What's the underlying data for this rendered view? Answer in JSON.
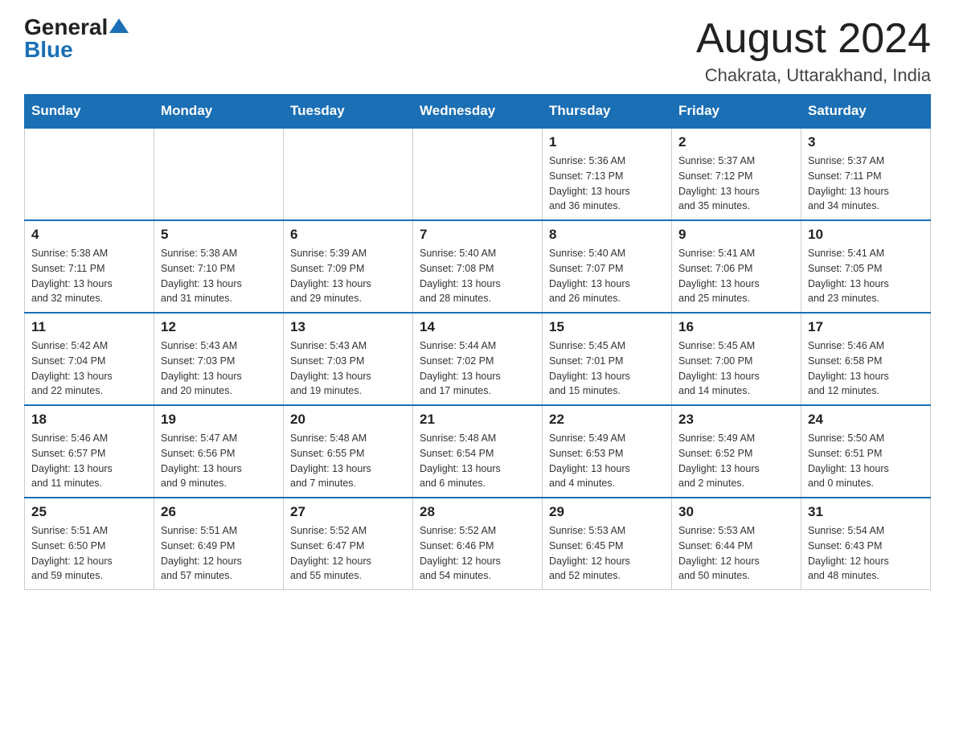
{
  "logo": {
    "general": "General",
    "blue": "Blue"
  },
  "header": {
    "month_title": "August 2024",
    "location": "Chakrata, Uttarakhand, India"
  },
  "weekdays": [
    "Sunday",
    "Monday",
    "Tuesday",
    "Wednesday",
    "Thursday",
    "Friday",
    "Saturday"
  ],
  "weeks": [
    [
      {
        "day": "",
        "info": ""
      },
      {
        "day": "",
        "info": ""
      },
      {
        "day": "",
        "info": ""
      },
      {
        "day": "",
        "info": ""
      },
      {
        "day": "1",
        "info": "Sunrise: 5:36 AM\nSunset: 7:13 PM\nDaylight: 13 hours\nand 36 minutes."
      },
      {
        "day": "2",
        "info": "Sunrise: 5:37 AM\nSunset: 7:12 PM\nDaylight: 13 hours\nand 35 minutes."
      },
      {
        "day": "3",
        "info": "Sunrise: 5:37 AM\nSunset: 7:11 PM\nDaylight: 13 hours\nand 34 minutes."
      }
    ],
    [
      {
        "day": "4",
        "info": "Sunrise: 5:38 AM\nSunset: 7:11 PM\nDaylight: 13 hours\nand 32 minutes."
      },
      {
        "day": "5",
        "info": "Sunrise: 5:38 AM\nSunset: 7:10 PM\nDaylight: 13 hours\nand 31 minutes."
      },
      {
        "day": "6",
        "info": "Sunrise: 5:39 AM\nSunset: 7:09 PM\nDaylight: 13 hours\nand 29 minutes."
      },
      {
        "day": "7",
        "info": "Sunrise: 5:40 AM\nSunset: 7:08 PM\nDaylight: 13 hours\nand 28 minutes."
      },
      {
        "day": "8",
        "info": "Sunrise: 5:40 AM\nSunset: 7:07 PM\nDaylight: 13 hours\nand 26 minutes."
      },
      {
        "day": "9",
        "info": "Sunrise: 5:41 AM\nSunset: 7:06 PM\nDaylight: 13 hours\nand 25 minutes."
      },
      {
        "day": "10",
        "info": "Sunrise: 5:41 AM\nSunset: 7:05 PM\nDaylight: 13 hours\nand 23 minutes."
      }
    ],
    [
      {
        "day": "11",
        "info": "Sunrise: 5:42 AM\nSunset: 7:04 PM\nDaylight: 13 hours\nand 22 minutes."
      },
      {
        "day": "12",
        "info": "Sunrise: 5:43 AM\nSunset: 7:03 PM\nDaylight: 13 hours\nand 20 minutes."
      },
      {
        "day": "13",
        "info": "Sunrise: 5:43 AM\nSunset: 7:03 PM\nDaylight: 13 hours\nand 19 minutes."
      },
      {
        "day": "14",
        "info": "Sunrise: 5:44 AM\nSunset: 7:02 PM\nDaylight: 13 hours\nand 17 minutes."
      },
      {
        "day": "15",
        "info": "Sunrise: 5:45 AM\nSunset: 7:01 PM\nDaylight: 13 hours\nand 15 minutes."
      },
      {
        "day": "16",
        "info": "Sunrise: 5:45 AM\nSunset: 7:00 PM\nDaylight: 13 hours\nand 14 minutes."
      },
      {
        "day": "17",
        "info": "Sunrise: 5:46 AM\nSunset: 6:58 PM\nDaylight: 13 hours\nand 12 minutes."
      }
    ],
    [
      {
        "day": "18",
        "info": "Sunrise: 5:46 AM\nSunset: 6:57 PM\nDaylight: 13 hours\nand 11 minutes."
      },
      {
        "day": "19",
        "info": "Sunrise: 5:47 AM\nSunset: 6:56 PM\nDaylight: 13 hours\nand 9 minutes."
      },
      {
        "day": "20",
        "info": "Sunrise: 5:48 AM\nSunset: 6:55 PM\nDaylight: 13 hours\nand 7 minutes."
      },
      {
        "day": "21",
        "info": "Sunrise: 5:48 AM\nSunset: 6:54 PM\nDaylight: 13 hours\nand 6 minutes."
      },
      {
        "day": "22",
        "info": "Sunrise: 5:49 AM\nSunset: 6:53 PM\nDaylight: 13 hours\nand 4 minutes."
      },
      {
        "day": "23",
        "info": "Sunrise: 5:49 AM\nSunset: 6:52 PM\nDaylight: 13 hours\nand 2 minutes."
      },
      {
        "day": "24",
        "info": "Sunrise: 5:50 AM\nSunset: 6:51 PM\nDaylight: 13 hours\nand 0 minutes."
      }
    ],
    [
      {
        "day": "25",
        "info": "Sunrise: 5:51 AM\nSunset: 6:50 PM\nDaylight: 12 hours\nand 59 minutes."
      },
      {
        "day": "26",
        "info": "Sunrise: 5:51 AM\nSunset: 6:49 PM\nDaylight: 12 hours\nand 57 minutes."
      },
      {
        "day": "27",
        "info": "Sunrise: 5:52 AM\nSunset: 6:47 PM\nDaylight: 12 hours\nand 55 minutes."
      },
      {
        "day": "28",
        "info": "Sunrise: 5:52 AM\nSunset: 6:46 PM\nDaylight: 12 hours\nand 54 minutes."
      },
      {
        "day": "29",
        "info": "Sunrise: 5:53 AM\nSunset: 6:45 PM\nDaylight: 12 hours\nand 52 minutes."
      },
      {
        "day": "30",
        "info": "Sunrise: 5:53 AM\nSunset: 6:44 PM\nDaylight: 12 hours\nand 50 minutes."
      },
      {
        "day": "31",
        "info": "Sunrise: 5:54 AM\nSunset: 6:43 PM\nDaylight: 12 hours\nand 48 minutes."
      }
    ]
  ]
}
